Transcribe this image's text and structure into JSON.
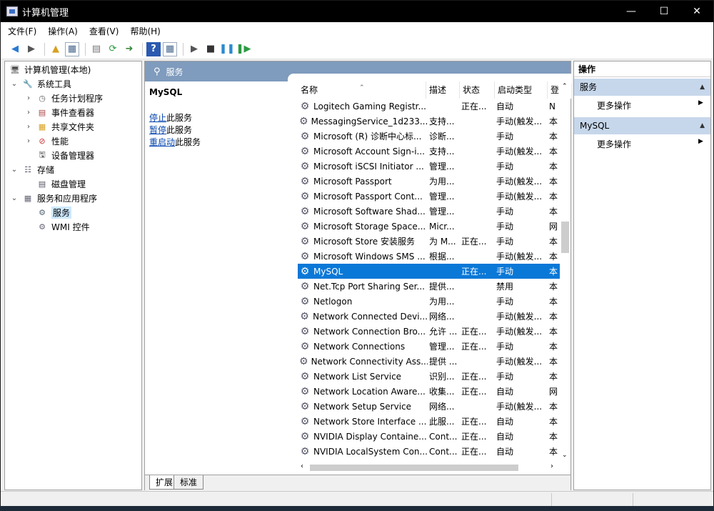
{
  "window": {
    "title": "计算机管理"
  },
  "titlebar": {
    "minimize": "—",
    "maximize": "☐",
    "close": "✕"
  },
  "menu": [
    "文件(F)",
    "操作(A)",
    "查看(V)",
    "帮助(H)"
  ],
  "toolbar": {
    "icons": [
      "back-icon",
      "forward-icon",
      "up-folder-icon",
      "show-tree-icon",
      "properties-icon",
      "refresh-icon",
      "export-icon",
      "help-icon",
      "view-icon",
      "start-icon",
      "stop-icon",
      "pause-icon",
      "restart-icon"
    ]
  },
  "tree": {
    "root": "计算机管理(本地)",
    "system_tools": "系统工具",
    "task_scheduler": "任务计划程序",
    "event_viewer": "事件查看器",
    "shared_folders": "共享文件夹",
    "performance": "性能",
    "device_manager": "设备管理器",
    "storage": "存储",
    "disk_management": "磁盘管理",
    "services_apps": "服务和应用程序",
    "services": "服务",
    "wmi": "WMI 控件"
  },
  "center": {
    "header": "服务",
    "selected_name": "MySQL",
    "actions": [
      {
        "link": "停止",
        "rest": "此服务"
      },
      {
        "link": "暂停",
        "rest": "此服务"
      },
      {
        "link": "重启动",
        "rest": "此服务"
      }
    ],
    "columns": [
      "名称",
      "描述",
      "状态",
      "启动类型",
      "登"
    ],
    "rows": [
      {
        "name": "Logitech Gaming Registr...",
        "desc": "",
        "status": "正在...",
        "startup": "自动",
        "logon": "N"
      },
      {
        "name": "MessagingService_1d233...",
        "desc": "支持...",
        "status": "",
        "startup": "手动(触发...",
        "logon": "本"
      },
      {
        "name": "Microsoft (R) 诊断中心标...",
        "desc": "诊断...",
        "status": "",
        "startup": "手动",
        "logon": "本"
      },
      {
        "name": "Microsoft Account Sign-i...",
        "desc": "支持...",
        "status": "",
        "startup": "手动(触发...",
        "logon": "本"
      },
      {
        "name": "Microsoft iSCSI Initiator ...",
        "desc": "管理...",
        "status": "",
        "startup": "手动",
        "logon": "本"
      },
      {
        "name": "Microsoft Passport",
        "desc": "为用...",
        "status": "",
        "startup": "手动(触发...",
        "logon": "本"
      },
      {
        "name": "Microsoft Passport Cont...",
        "desc": "管理...",
        "status": "",
        "startup": "手动(触发...",
        "logon": "本"
      },
      {
        "name": "Microsoft Software Shad...",
        "desc": "管理...",
        "status": "",
        "startup": "手动",
        "logon": "本"
      },
      {
        "name": "Microsoft Storage Space...",
        "desc": "Micr...",
        "status": "",
        "startup": "手动",
        "logon": "网"
      },
      {
        "name": "Microsoft Store 安装服务",
        "desc": "为 M...",
        "status": "正在...",
        "startup": "手动",
        "logon": "本"
      },
      {
        "name": "Microsoft Windows SMS ...",
        "desc": "根据...",
        "status": "",
        "startup": "手动(触发...",
        "logon": "本"
      },
      {
        "name": "MySQL",
        "desc": "",
        "status": "正在...",
        "startup": "手动",
        "logon": "本",
        "selected": true
      },
      {
        "name": "Net.Tcp Port Sharing Ser...",
        "desc": "提供...",
        "status": "",
        "startup": "禁用",
        "logon": "本"
      },
      {
        "name": "Netlogon",
        "desc": "为用...",
        "status": "",
        "startup": "手动",
        "logon": "本"
      },
      {
        "name": "Network Connected Devi...",
        "desc": "网络...",
        "status": "",
        "startup": "手动(触发...",
        "logon": "本"
      },
      {
        "name": "Network Connection Bro...",
        "desc": "允许 ...",
        "status": "正在...",
        "startup": "手动(触发...",
        "logon": "本"
      },
      {
        "name": "Network Connections",
        "desc": "管理...",
        "status": "正在...",
        "startup": "手动",
        "logon": "本"
      },
      {
        "name": "Network Connectivity Ass...",
        "desc": "提供 ...",
        "status": "",
        "startup": "手动(触发...",
        "logon": "本"
      },
      {
        "name": "Network List Service",
        "desc": "识别...",
        "status": "正在...",
        "startup": "手动",
        "logon": "本"
      },
      {
        "name": "Network Location Aware...",
        "desc": "收集...",
        "status": "正在...",
        "startup": "自动",
        "logon": "网"
      },
      {
        "name": "Network Setup Service",
        "desc": "网络...",
        "status": "",
        "startup": "手动(触发...",
        "logon": "本"
      },
      {
        "name": "Network Store Interface ...",
        "desc": "此服...",
        "status": "正在...",
        "startup": "自动",
        "logon": "本"
      },
      {
        "name": "NVIDIA Display Containe...",
        "desc": "Cont...",
        "status": "正在...",
        "startup": "自动",
        "logon": "本"
      },
      {
        "name": "NVIDIA LocalSystem Con...",
        "desc": "Cont...",
        "status": "正在...",
        "startup": "自动",
        "logon": "本"
      }
    ],
    "tabs": [
      "扩展",
      "标准"
    ]
  },
  "right": {
    "header": "操作",
    "sections": [
      {
        "title": "服务",
        "item": "更多操作"
      },
      {
        "title": "MySQL",
        "item": "更多操作"
      }
    ]
  }
}
